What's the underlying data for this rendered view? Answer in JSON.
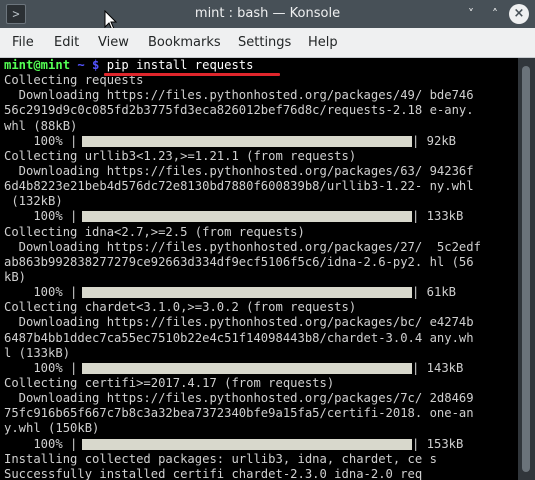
{
  "window": {
    "title": "mint : bash — Konsole",
    "app_icon_glyph": ">",
    "minimize_glyph": "˅",
    "maximize_glyph": "˄",
    "close_glyph": "×"
  },
  "menu": [
    "File",
    "Edit",
    "View",
    "Bookmarks",
    "Settings",
    "Help"
  ],
  "terminal": {
    "prompt_user": "mint@mint",
    "prompt_tilde": " ~ $ ",
    "command": "pip install requests",
    "lines": [
      "Collecting requests",
      "  Downloading https://files.pythonhosted.org/packages/49/ bde746",
      "56c2919d9c0c085fd2b3775fd3eca826012bef76d8c/requests-2.18 e-any.",
      "whl (88kB)",
      "__PBAR__0",
      "Collecting urllib3<1.23,>=1.21.1 (from requests)",
      "  Downloading https://files.pythonhosted.org/packages/63/ 94236f",
      "6d4b8223e21beb4d576dc72e8130bd7880f600839b8/urllib3-1.22- ny.whl",
      " (132kB)",
      "__PBAR__1",
      "Collecting idna<2.7,>=2.5 (from requests)",
      "  Downloading https://files.pythonhosted.org/packages/27/  5c2edf",
      "ab863b992838277279ce92663d334df9ecf5106f5c6/idna-2.6-py2. hl (56",
      "kB)",
      "__PBAR__2",
      "Collecting chardet<3.1.0,>=3.0.2 (from requests)",
      "  Downloading https://files.pythonhosted.org/packages/bc/ e4274b",
      "6487b4bb1ddec7ca55ec7510b22e4c51f14098443b8/chardet-3.0.4 any.wh",
      "l (133kB)",
      "__PBAR__3",
      "Collecting certifi>=2017.4.17 (from requests)",
      "  Downloading https://files.pythonhosted.org/packages/7c/ 2d8469",
      "75fc916b65f667c7b8c3a32bea7372340bfe9a15fa5/certifi-2018. one-an",
      "y.whl (150kB)",
      "__PBAR__4",
      "Installing collected packages: urllib3, idna, chardet, ce s",
      "Successfully installed certifi chardet-2.3.0 idna-2.0 req"
    ],
    "progress_bars": [
      {
        "percent_label": "    100% |",
        "fraction": 1.0,
        "size": "| 92kB"
      },
      {
        "percent_label": "    100% |",
        "fraction": 1.0,
        "size": "| 133kB"
      },
      {
        "percent_label": "    100% |",
        "fraction": 1.0,
        "size": "| 61kB"
      },
      {
        "percent_label": "    100% |",
        "fraction": 1.0,
        "size": "| 143kB"
      },
      {
        "percent_label": "    100% |",
        "fraction": 1.0,
        "size": "| 153kB"
      }
    ]
  },
  "colors": {
    "prompt_user": "#54ff54",
    "prompt_tilde": "#5454ff",
    "annotation_underline": "#e0262c",
    "progress_fill": "#d8d8cc"
  },
  "scrollbar": {
    "position": "bottom"
  }
}
